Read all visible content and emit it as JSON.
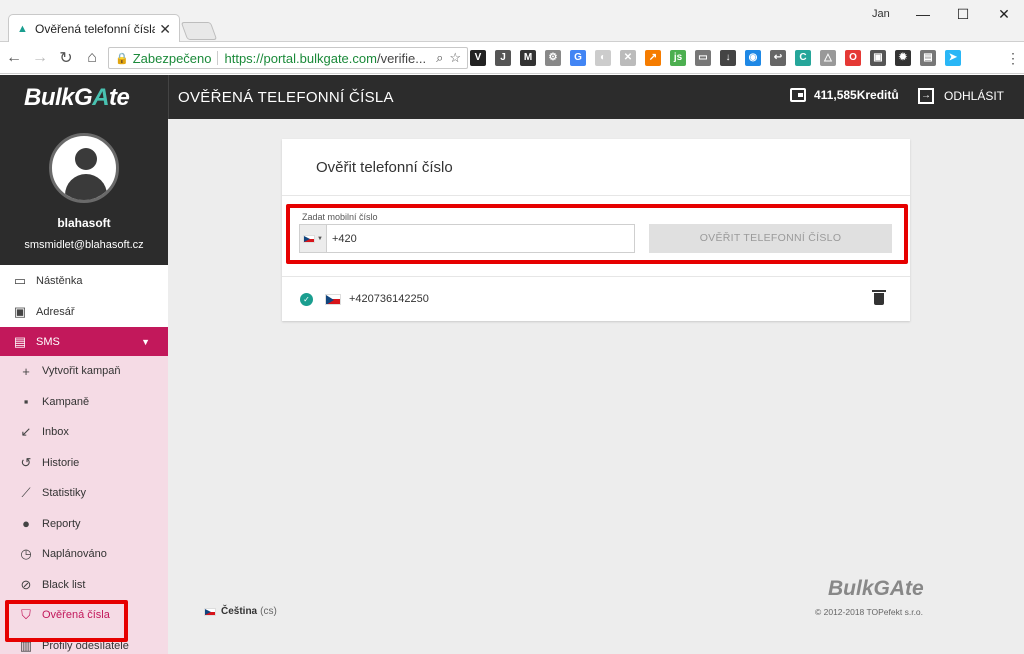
{
  "browser": {
    "tab_title": "Ověřená telefonní čísla | B",
    "user": "Jan",
    "secure_label": "Zabezpečeno",
    "url_scheme_host": "https://portal.bulkgate.com",
    "url_rest": "/verifie..."
  },
  "header": {
    "logo_text": "BulkG",
    "logo_accent": "A",
    "logo_tail": "te",
    "page_title": "OVĚŘENÁ TELEFONNÍ ČÍSLA",
    "credits": "411,585Kreditů",
    "logout": "ODHLÁSIT"
  },
  "profile": {
    "username": "blahasoft",
    "email": "smsmidlet@blahasoft.cz"
  },
  "sidebar": {
    "items": [
      {
        "label": "Nástěnka",
        "icon": "monitor-icon"
      },
      {
        "label": "Adresář",
        "icon": "contact-book-icon"
      }
    ],
    "sms": {
      "label": "SMS",
      "icon": "chat-icon"
    },
    "submenu": [
      {
        "label": "Vytvořit kampaň",
        "icon": "plus-icon"
      },
      {
        "label": "Kampaně",
        "icon": "message-icon"
      },
      {
        "label": "Inbox",
        "icon": "arrow-inbox-icon"
      },
      {
        "label": "Historie",
        "icon": "history-icon"
      },
      {
        "label": "Statistiky",
        "icon": "chart-line-icon"
      },
      {
        "label": "Reporty",
        "icon": "alert-icon"
      },
      {
        "label": "Naplánováno",
        "icon": "alarm-icon"
      },
      {
        "label": "Black list",
        "icon": "block-icon"
      },
      {
        "label": "Ověřená čísla",
        "icon": "shield-check-icon",
        "active": true
      },
      {
        "label": "Profily odesílatele",
        "icon": "profile-icon"
      }
    ]
  },
  "card": {
    "title": "Ověřit telefonní číslo",
    "input_label": "Zadat mobilní číslo",
    "input_value": "+420",
    "verify_button": "OVĚŘIT TELEFONNÍ ČÍSLO",
    "verified_numbers": [
      {
        "number": "+420736142250"
      }
    ]
  },
  "footer": {
    "language": "Čeština",
    "language_code": "(cs)",
    "logo": "BulkGAte",
    "copyright": "© 2012-2018 TOPefekt s.r.o."
  },
  "colors": {
    "accent": "#c2185b",
    "brand_teal": "#48c1b0",
    "highlight": "#e60000"
  }
}
